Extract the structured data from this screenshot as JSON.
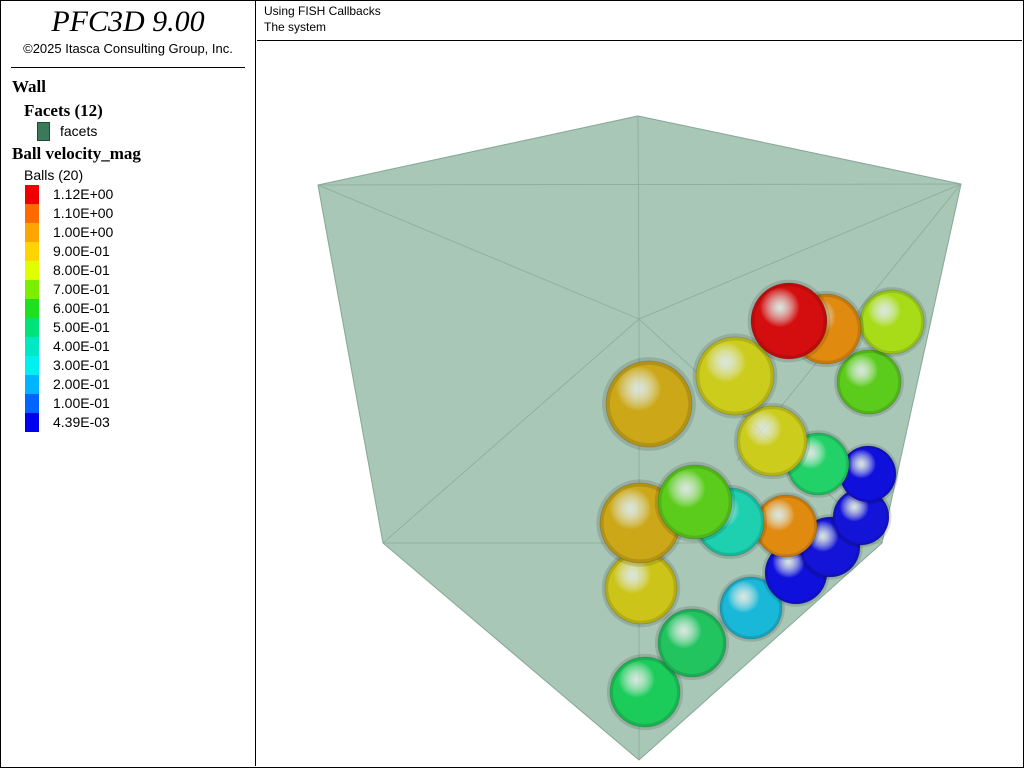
{
  "header": {
    "app_title": "PFC3D 9.00",
    "copyright": "©2025 Itasca Consulting Group, Inc.",
    "subtitle_1": "Using FISH Callbacks",
    "subtitle_2": "The system"
  },
  "legend": {
    "wall_heading": "Wall",
    "facets_heading": "Facets (12)",
    "facet_label": "facets",
    "facet_color": "#3a7a5a",
    "ball_heading": "Ball velocity_mag",
    "balls_count": "Balls (20)",
    "colorbar": [
      {
        "label": "1.12E+00",
        "color": "#ee0000"
      },
      {
        "label": "1.10E+00",
        "color": "#ff6a00"
      },
      {
        "label": "1.00E+00",
        "color": "#ffa500"
      },
      {
        "label": "9.00E-01",
        "color": "#ffd400"
      },
      {
        "label": "8.00E-01",
        "color": "#e0ff00"
      },
      {
        "label": "7.00E-01",
        "color": "#7dee00"
      },
      {
        "label": "6.00E-01",
        "color": "#1ee01e"
      },
      {
        "label": "5.00E-01",
        "color": "#00e27a"
      },
      {
        "label": "4.00E-01",
        "color": "#00e8c4"
      },
      {
        "label": "3.00E-01",
        "color": "#00f0f0"
      },
      {
        "label": "2.00E-01",
        "color": "#00b4ff"
      },
      {
        "label": "1.00E-01",
        "color": "#0064ff"
      },
      {
        "label": "4.39E-03",
        "color": "#0000ee"
      }
    ]
  },
  "scene": {
    "wall_fill": "#a9c7b7",
    "wall_edge": "#8aaa9a",
    "balls": [
      {
        "velocity_mag": 0.58,
        "color": "#1ccc5a"
      },
      {
        "velocity_mag": 0.55,
        "color": "#22c460"
      },
      {
        "velocity_mag": 0.35,
        "color": "#1ab8d8"
      },
      {
        "velocity_mag": 0.88,
        "color": "#ccc418"
      },
      {
        "velocity_mag": 0.05,
        "color": "#1010dd"
      },
      {
        "velocity_mag": 0.06,
        "color": "#1414d8"
      },
      {
        "velocity_mag": 0.07,
        "color": "#1414d8"
      },
      {
        "velocity_mag": 0.04,
        "color": "#1010dd"
      },
      {
        "velocity_mag": 0.98,
        "color": "#e08a10"
      },
      {
        "velocity_mag": 0.45,
        "color": "#1ed0b0"
      },
      {
        "velocity_mag": 0.92,
        "color": "#cca818"
      },
      {
        "velocity_mag": 0.72,
        "color": "#5ccc1c"
      },
      {
        "velocity_mag": 0.55,
        "color": "#22d268"
      },
      {
        "velocity_mag": 0.88,
        "color": "#cccc1c"
      },
      {
        "velocity_mag": 0.92,
        "color": "#cca818"
      },
      {
        "velocity_mag": 0.88,
        "color": "#cccc1c"
      },
      {
        "velocity_mag": 0.7,
        "color": "#5ccc1c"
      },
      {
        "velocity_mag": 0.78,
        "color": "#a8dc18"
      },
      {
        "velocity_mag": 1.0,
        "color": "#e08a10"
      },
      {
        "velocity_mag": 1.12,
        "color": "#d40e0e"
      }
    ]
  }
}
